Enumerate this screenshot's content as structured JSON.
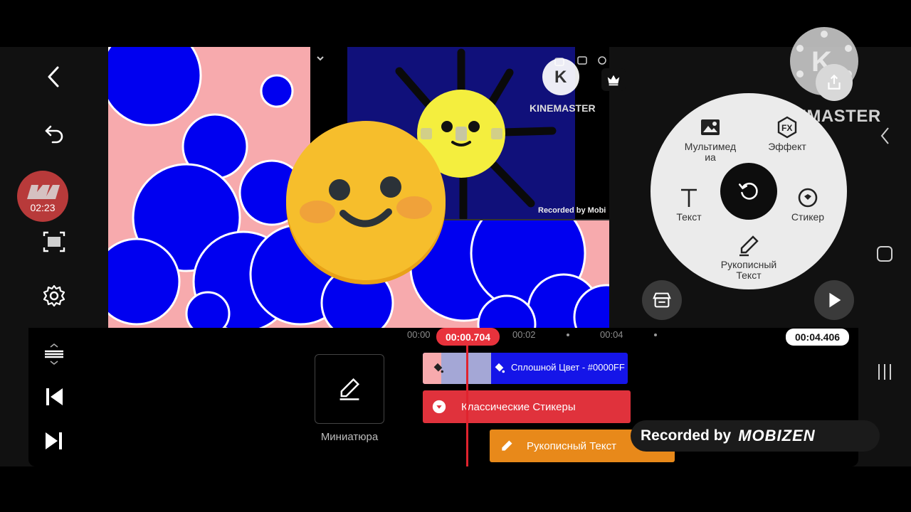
{
  "preview": {
    "pip_brand": "KINEMASTER",
    "pip_recorded": "Recorded by Mobi"
  },
  "overlay": {
    "recorder_time": "02:23",
    "watermark": "KINEMASTER"
  },
  "menu": {
    "media": "Мультимед\nиа",
    "effect": "Эффект",
    "text": "Текст",
    "sticker": "Стикер",
    "handwriting": "Рукописный\nТекст"
  },
  "timeline": {
    "current_time": "00:00.704",
    "total_time": "00:04.406",
    "ruler": [
      "00:00",
      "00:02",
      "00:04"
    ],
    "thumbnail_label": "Миниатюра",
    "clips": {
      "solid": "Сплошной Цвет - #0000FF",
      "stickers": "Классические Стикеры",
      "handwriting": "Рукописный Текст"
    }
  },
  "recorded": {
    "prefix": "Recorded by",
    "brand": "MOBIZEN"
  },
  "colors": {
    "accent_red": "#e8323c",
    "blue_clip": "#1515e8",
    "sticker_clip": "#e0323c",
    "handwriting_clip": "#e8891a",
    "preview_pink": "#f7aaad",
    "preview_blue": "#0000f0"
  }
}
